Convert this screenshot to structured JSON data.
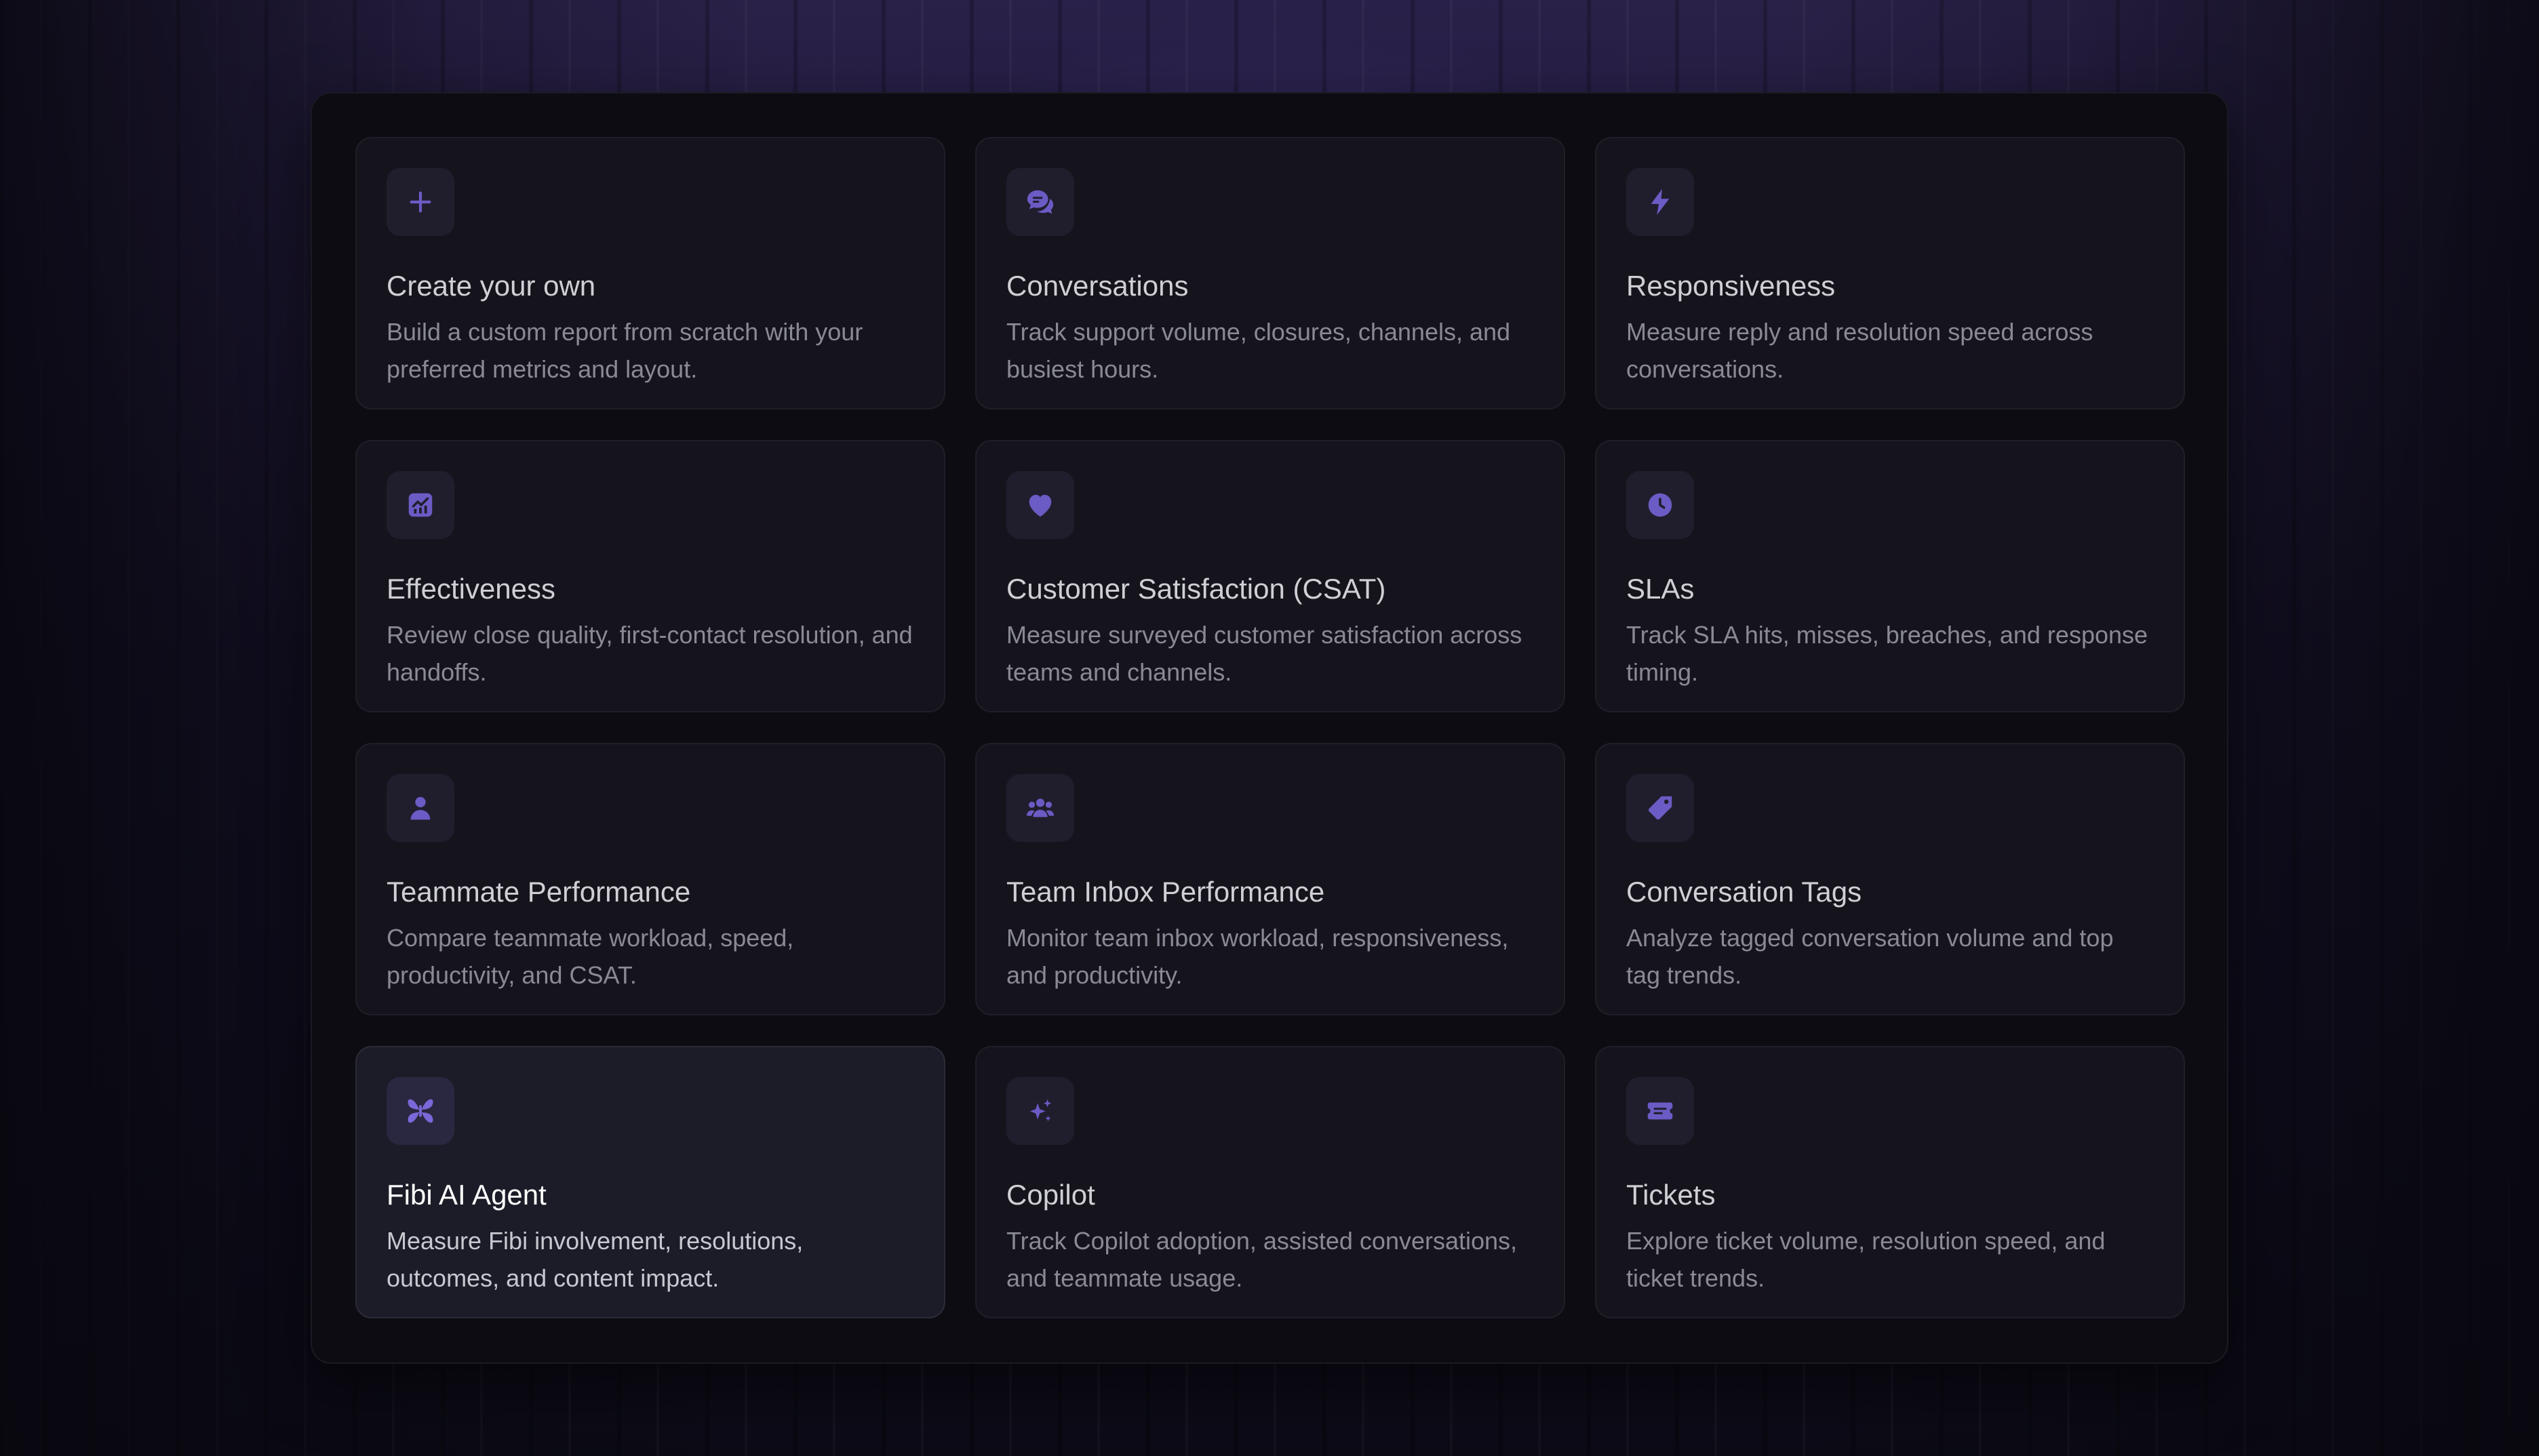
{
  "colors": {
    "accent": "#6b5bc4",
    "panel_background": "#0d0c12",
    "card_background": "#15141d",
    "active_card_background": "#1c1c28"
  },
  "cards": [
    {
      "title": "Create your own",
      "description": "Build a custom report from scratch with your preferred metrics and layout.",
      "icon": "plus-icon",
      "active": false
    },
    {
      "title": "Conversations",
      "description": "Track support volume, closures, channels, and busiest hours.",
      "icon": "chat-bubbles-icon",
      "active": false
    },
    {
      "title": "Responsiveness",
      "description": "Measure reply and resolution speed across conversations.",
      "icon": "lightning-icon",
      "active": false
    },
    {
      "title": "Effectiveness",
      "description": "Review close quality, first-contact resolution, and handoffs.",
      "icon": "chart-up-icon",
      "active": false
    },
    {
      "title": "Customer Satisfaction (CSAT)",
      "description": "Measure surveyed customer satisfaction across teams and channels.",
      "icon": "heart-icon",
      "active": false
    },
    {
      "title": "SLAs",
      "description": "Track SLA hits, misses, breaches, and response timing.",
      "icon": "clock-icon",
      "active": false
    },
    {
      "title": "Teammate Performance",
      "description": "Compare teammate workload, speed, productivity, and CSAT.",
      "icon": "person-icon",
      "active": false
    },
    {
      "title": "Team Inbox Performance",
      "description": "Monitor team inbox workload, responsiveness, and productivity.",
      "icon": "people-icon",
      "active": false
    },
    {
      "title": "Conversation Tags",
      "description": "Analyze tagged conversation volume and top tag trends.",
      "icon": "tag-icon",
      "active": false
    },
    {
      "title": "Fibi AI Agent",
      "description": "Measure Fibi involvement, resolutions, outcomes, and content impact.",
      "icon": "butterfly-icon",
      "active": true
    },
    {
      "title": "Copilot",
      "description": "Track Copilot adoption, assisted conversations, and teammate usage.",
      "icon": "sparkles-icon",
      "active": false
    },
    {
      "title": "Tickets",
      "description": "Explore ticket volume, resolution speed, and ticket trends.",
      "icon": "ticket-icon",
      "active": false
    }
  ]
}
